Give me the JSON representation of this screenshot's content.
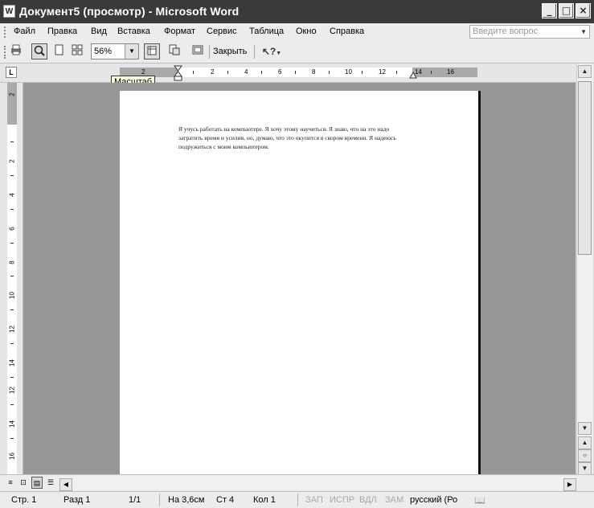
{
  "window": {
    "title": "Документ5 (просмотр) - Microsoft Word",
    "app_icon": "W"
  },
  "menu": {
    "items": [
      "Файл",
      "Правка",
      "Вид",
      "Вставка",
      "Формат",
      "Сервис",
      "Таблица",
      "Окно",
      "Справка"
    ],
    "help_placeholder": "Введите вопрос"
  },
  "toolbar": {
    "zoom_value": "56%",
    "close_label": "Закрыть",
    "tooltip": "Масштаб"
  },
  "ruler": {
    "h_numbers": [
      "2",
      "2",
      "4",
      "6",
      "8",
      "10",
      "12",
      "14",
      "16"
    ],
    "v_numbers": [
      "2",
      "2",
      "4",
      "6",
      "8",
      "10",
      "12",
      "14",
      "12",
      "14",
      "16"
    ]
  },
  "document": {
    "text": "Я учусь работать на компьютере. Я хочу этому научиться. Я знаю, что на это надо затратить время и усилия, но, думаю, что это окупится в скором времени. Я надеюсь подружиться с моим компьютером."
  },
  "status": {
    "page": "Стр. 1",
    "section": "Разд 1",
    "pages": "1/1",
    "at": "На 3,6см",
    "line": "Ст 4",
    "col": "Кол 1",
    "rec": "ЗАП",
    "trk": "ИСПР",
    "ext": "ВДЛ",
    "ovr": "ЗАМ",
    "language": "русский (Ро"
  }
}
